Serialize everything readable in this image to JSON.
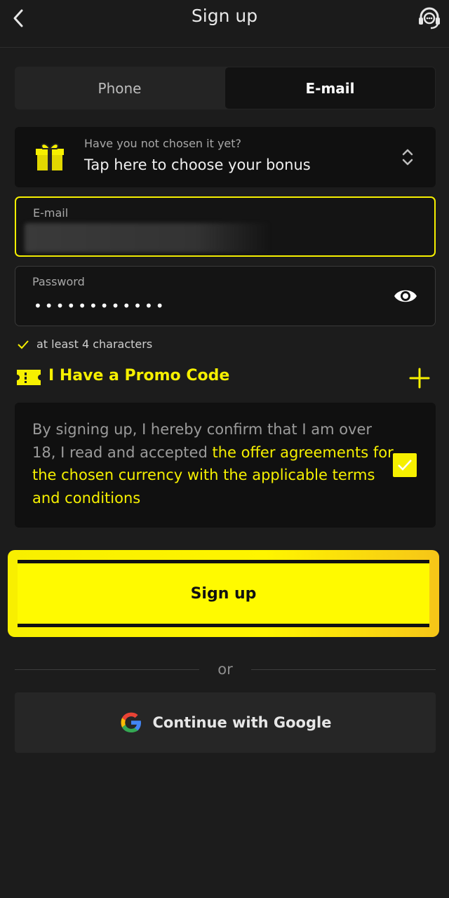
{
  "header": {
    "title": "Sign up"
  },
  "tabs": [
    {
      "label": "Phone"
    },
    {
      "label": "E-mail"
    }
  ],
  "bonus": {
    "hint": "Have you not chosen it yet?",
    "label": "Tap here to choose your bonus"
  },
  "email_field": {
    "label": "E-mail"
  },
  "password_field": {
    "label": "Password",
    "value": "••••••••••••"
  },
  "password_hint": "at least 4 characters",
  "promo": {
    "label": "I Have a Promo Code"
  },
  "terms": {
    "text": "By signing up, I hereby confirm that I am over 18, I read and accepted ",
    "link": "the offer agreements for the chosen currency with the applicable terms and conditions",
    "checked": true
  },
  "signup_button": "Sign up",
  "divider": "or",
  "google_button": "Continue with Google",
  "colors": {
    "accent": "#f6f000",
    "background": "#1c1c1c",
    "panel": "#101010"
  }
}
